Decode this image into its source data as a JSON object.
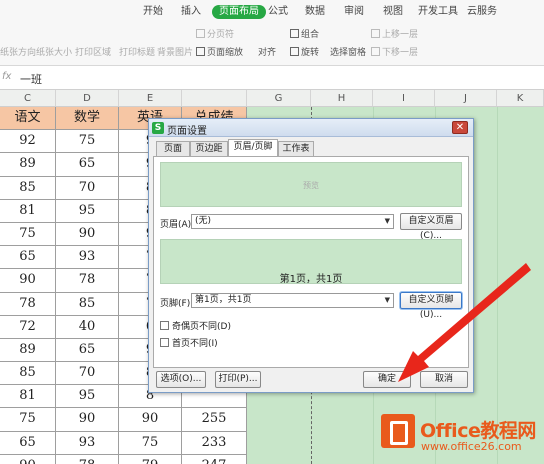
{
  "ribbon": {
    "tabs": [
      "开始",
      "插入",
      "页面布局",
      "公式",
      "数据",
      "审阅",
      "视图",
      "开发工具",
      "云服务"
    ],
    "active_tab": "页面布局",
    "tools_row1": [
      "分页符",
      "组合",
      "上移一层"
    ],
    "tools_row2": [
      "纸张方向",
      "纸张大小",
      "打印区域",
      "打印标题",
      "背景图片",
      "页面缩放",
      "对齐",
      "旋转",
      "选择窗格",
      "下移一层"
    ]
  },
  "formula_bar": {
    "fx": "fx",
    "value": "一班"
  },
  "columns": [
    "C",
    "D",
    "E",
    "F",
    "G",
    "H",
    "I",
    "J",
    "K"
  ],
  "table": {
    "headers": [
      "语文",
      "数学",
      "英语",
      "总成绩"
    ],
    "rows": [
      [
        "92",
        "75",
        "9",
        ""
      ],
      [
        "89",
        "65",
        "9",
        ""
      ],
      [
        "85",
        "70",
        "8",
        ""
      ],
      [
        "81",
        "95",
        "8",
        ""
      ],
      [
        "75",
        "90",
        "9",
        ""
      ],
      [
        "65",
        "93",
        "7",
        ""
      ],
      [
        "90",
        "78",
        "7",
        ""
      ],
      [
        "78",
        "85",
        "7",
        ""
      ],
      [
        "72",
        "40",
        "6",
        ""
      ],
      [
        "89",
        "65",
        "9",
        ""
      ],
      [
        "85",
        "70",
        "8",
        ""
      ],
      [
        "81",
        "95",
        "8",
        ""
      ],
      [
        "75",
        "90",
        "90",
        "255"
      ],
      [
        "65",
        "93",
        "75",
        "233"
      ],
      [
        "90",
        "78",
        "79",
        "247"
      ]
    ]
  },
  "dialog": {
    "title": "页面设置",
    "tabs": [
      "页面",
      "页边距",
      "页眉/页脚",
      "工作表"
    ],
    "active_tab": "页眉/页脚",
    "preview_label": "预览",
    "header_label": "页眉(A):",
    "header_value": "(无)",
    "custom_header_button": "自定义页眉(C)...",
    "footer_preview": "第1页，共1页",
    "footer_label": "页脚(F):",
    "footer_value": "第1页，共1页",
    "custom_footer_button": "自定义页脚(U)...",
    "odd_even_label": "奇偶页不同(D)",
    "first_page_label": "首页不同(I)",
    "options_button": "选项(O)...",
    "print_button": "打印(P)...",
    "ok_button": "确定",
    "cancel_button": "取消"
  },
  "watermark": {
    "brand": "Office教程网",
    "url": "www.office26.com"
  },
  "colors": {
    "accent": "#27a844",
    "header_cells": "#f6c6a4",
    "sheet_green": "#c8e6c9",
    "arrow": "#e8261b",
    "brand": "#e95a1c"
  }
}
